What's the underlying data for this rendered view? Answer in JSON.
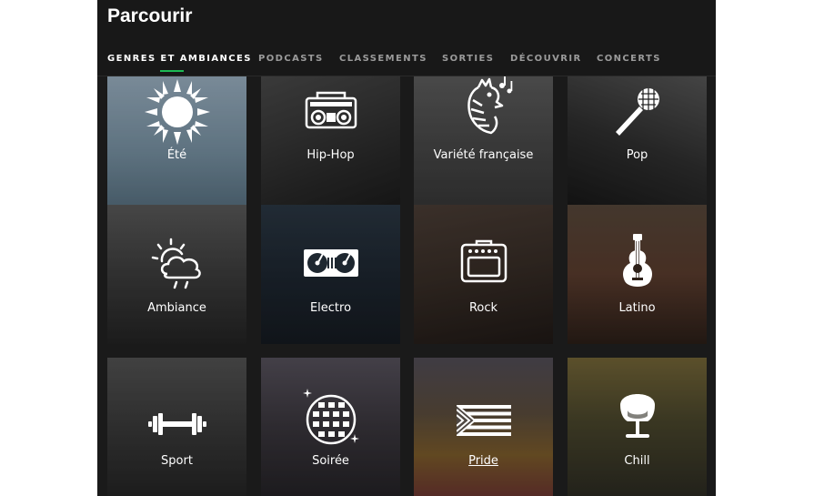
{
  "page": {
    "title": "Parcourir"
  },
  "tabs": [
    {
      "label": "GENRES ET AMBIANCES",
      "active": true
    },
    {
      "label": "PODCASTS",
      "active": false
    },
    {
      "label": "CLASSEMENTS",
      "active": false
    },
    {
      "label": "SORTIES",
      "active": false
    },
    {
      "label": "DÉCOUVRIR",
      "active": false
    },
    {
      "label": "CONCERTS",
      "active": false
    }
  ],
  "colors": {
    "accent": "#1db954",
    "background": "#1a1a1a",
    "text": "#ffffff",
    "muted": "#9b9b9b"
  },
  "tiles": [
    {
      "label": "Été",
      "icon": "sun-icon"
    },
    {
      "label": "Hip-Hop",
      "icon": "boombox-icon"
    },
    {
      "label": "Variété française",
      "icon": "rooster-icon"
    },
    {
      "label": "Pop",
      "icon": "microphone-icon"
    },
    {
      "label": "Ambiance",
      "icon": "weather-icon"
    },
    {
      "label": "Electro",
      "icon": "turntable-icon"
    },
    {
      "label": "Rock",
      "icon": "amplifier-icon"
    },
    {
      "label": "Latino",
      "icon": "guitar-icon"
    },
    {
      "label": "Sport",
      "icon": "dumbbell-icon"
    },
    {
      "label": "Soirée",
      "icon": "disco-ball-icon"
    },
    {
      "label": "Pride",
      "icon": "pride-flag-icon"
    },
    {
      "label": "Chill",
      "icon": "egg-chair-icon"
    }
  ]
}
